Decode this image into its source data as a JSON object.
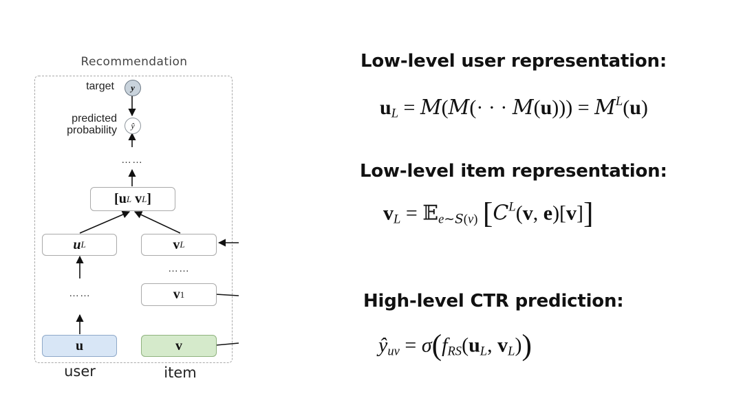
{
  "diagram": {
    "title": "Recommendation",
    "target_label": "target",
    "target_symbol": "y",
    "predicted_label_line1": "predicted",
    "predicted_label_line2": "probability",
    "predicted_symbol": "ŷ",
    "dots": "……",
    "concat_node": {
      "u": "u",
      "u_sub": "L",
      "v": "v",
      "v_sub": "L"
    },
    "uL_node": {
      "main": "u",
      "sub": "L"
    },
    "vL_node": {
      "main": "v",
      "sub": "L"
    },
    "v1_node": {
      "main": "v",
      "sub": "1"
    },
    "u_node": "u",
    "v_node": "v",
    "user_label": "user",
    "item_label": "item",
    "colors": {
      "user_fill": "#d8e6f6",
      "item_fill": "#d5eacb",
      "target_fill": "#c9d3dc"
    }
  },
  "sections": [
    {
      "heading": "Low-level user representation:"
    },
    {
      "heading": "Low-level item representation:"
    },
    {
      "heading": "High-level CTR prediction:"
    }
  ]
}
